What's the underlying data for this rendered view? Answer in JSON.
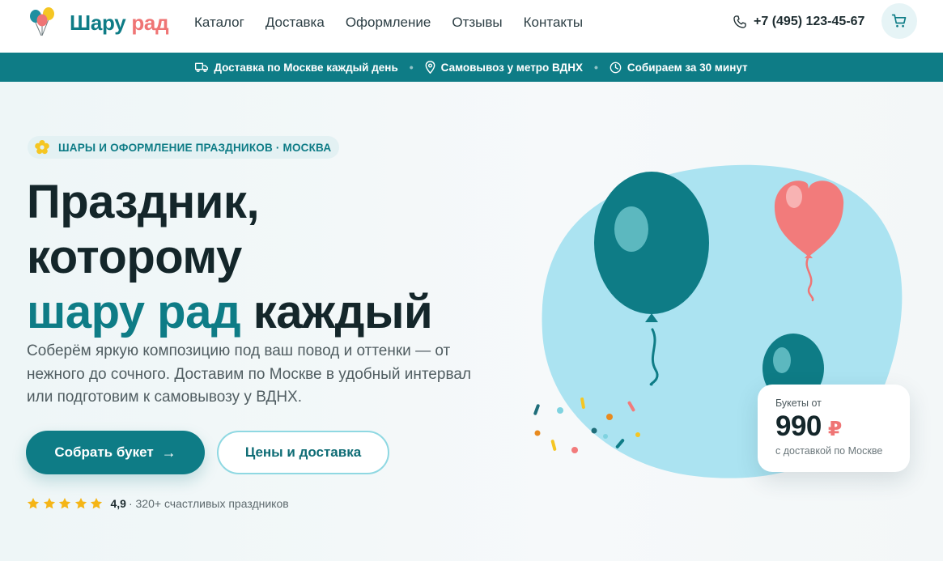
{
  "brand": {
    "name_part1": "Шару",
    "name_part2": "рад",
    "logo_icon": "balloons-logo-icon",
    "colors": {
      "teal": "#0e7c86",
      "coral": "#ef7575",
      "light_blue": "#aee5f2"
    }
  },
  "nav": {
    "items": [
      {
        "label": "Каталог"
      },
      {
        "label": "Доставка"
      },
      {
        "label": "Оформление"
      },
      {
        "label": "Отзывы"
      },
      {
        "label": "Контакты"
      }
    ]
  },
  "header": {
    "phone": "+7 (495) 123-45-67",
    "phone_icon": "phone-icon",
    "cart_icon": "cart-icon"
  },
  "infobar": {
    "items": [
      {
        "icon": "truck-icon",
        "label": "Доставка по Москве каждый день"
      },
      {
        "icon": "location-pin-icon",
        "label": "Самовывоз у метро ВДНХ"
      },
      {
        "icon": "clock-icon",
        "label": "Собираем за 30 минут"
      }
    ],
    "separator": "•"
  },
  "hero": {
    "tagline": "ШАРЫ И ОФОРМЛЕНИЕ ПРАЗДНИКОВ · МОСКВА",
    "tagline_icon": "flower-icon",
    "headline": {
      "line1": "Праздник,",
      "line2": "которому",
      "line3_accent": "шару рад",
      "line3_rest": " каждый"
    },
    "lead": "Соберём яркую композицию под ваш повод и оттенки — от нежного до сочного. Доставим по Москве в удобный интервал или подготовим к самовывозу у ВДНХ.",
    "primary_button": {
      "label": "Собрать букет",
      "arrow": "→"
    },
    "secondary_button": {
      "label": "Цены и доставка"
    },
    "rating": {
      "stars": 5,
      "value": "4,9",
      "text": "· 320+ счастливых праздников"
    }
  },
  "price_card": {
    "caption": "Букеты от",
    "price": "990",
    "currency": "₽",
    "note": "с доставкой по Москве"
  }
}
